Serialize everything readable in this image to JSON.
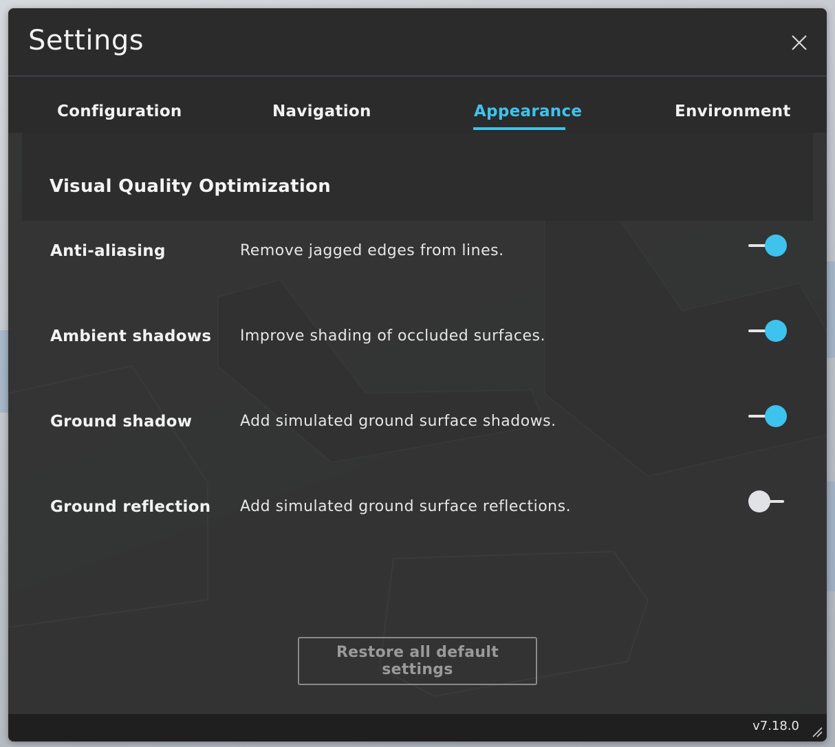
{
  "dialog": {
    "title": "Settings",
    "close_icon": "close-icon"
  },
  "tabs": [
    {
      "label": "Configuration",
      "active": false
    },
    {
      "label": "Navigation",
      "active": false
    },
    {
      "label": "Appearance",
      "active": true
    },
    {
      "label": "Environment",
      "active": false
    }
  ],
  "section": {
    "title": "Visual Quality Optimization"
  },
  "settings": [
    {
      "label": "Anti-aliasing",
      "description": "Remove jagged edges from lines.",
      "enabled": true
    },
    {
      "label": "Ambient shadows",
      "description": "Improve shading of occluded surfaces.",
      "enabled": true
    },
    {
      "label": "Ground shadow",
      "description": "Add simulated ground surface shadows.",
      "enabled": true
    },
    {
      "label": "Ground reflection",
      "description": "Add simulated ground surface reflections.",
      "enabled": false
    }
  ],
  "restore_button": {
    "label": "Restore all default settings"
  },
  "footer": {
    "version": "v7.18.0",
    "resize_icon": "resize-handle-icon"
  },
  "colors": {
    "accent": "#3ec3ee",
    "panel": "#2b2b2b",
    "footer": "#1f1f1f",
    "toggle_off": "#e0e2e6"
  }
}
